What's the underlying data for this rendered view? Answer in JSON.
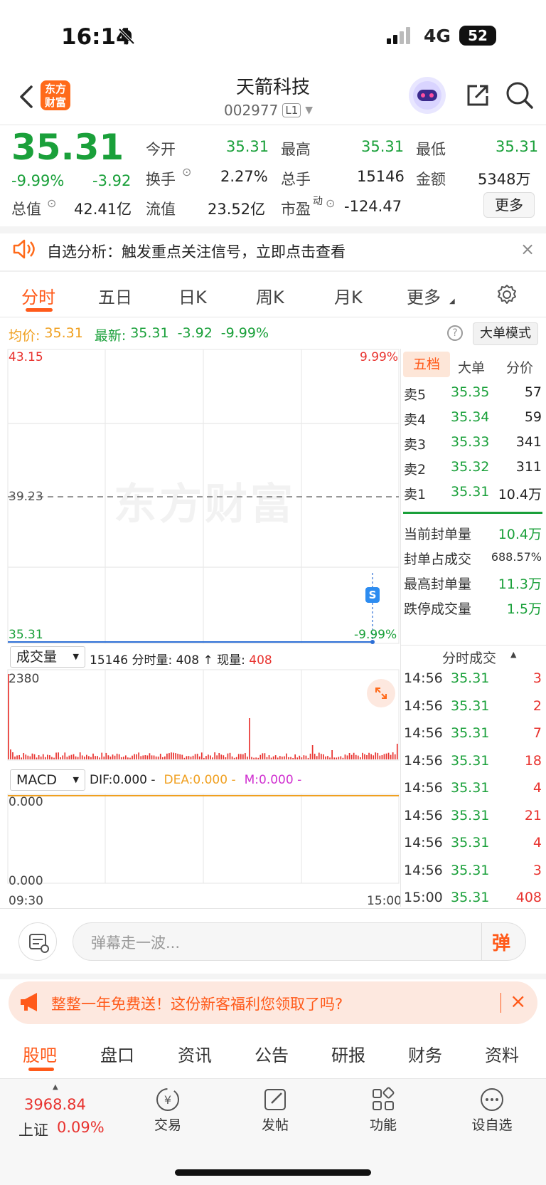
{
  "status": {
    "time": "16:14",
    "network": "4G",
    "battery": "52"
  },
  "header": {
    "logo_text": "东方财富",
    "stock_name": "天箭科技",
    "stock_code": "002977",
    "level": "L1"
  },
  "quote": {
    "price": "35.31",
    "change_pct": "-9.99%",
    "change": "-3.92",
    "open_label": "今开",
    "open": "35.31",
    "high_label": "最高",
    "high": "35.31",
    "low_label": "最低",
    "low": "35.31",
    "turnover_label": "换手",
    "turnover": "2.27%",
    "volume_label": "总手",
    "volume": "15146",
    "amount_label": "金额",
    "amount": "5348万",
    "mcap_label": "总值",
    "mcap": "42.41亿",
    "float_label": "流值",
    "float": "23.52亿",
    "pe_label": "市盈",
    "pe_sup": "动",
    "pe": "-124.47",
    "more_btn": "更多"
  },
  "banner": {
    "text": "自选分析：触发重点关注信号，立即点击查看"
  },
  "tabs": [
    "分时",
    "五日",
    "日K",
    "周K",
    "月K",
    "更多"
  ],
  "intraday": {
    "avg_label": "均价:",
    "avg": "35.31",
    "latest_label": "最新:",
    "latest": "35.31",
    "latest_change": "-3.92",
    "latest_pct": "-9.99%",
    "big_order_btn": "大单模式",
    "y_top": "43.15",
    "y_mid": "39.23",
    "y_bottom": "35.31",
    "pct_top": "9.99%",
    "pct_bottom": "-9.99%",
    "watermark": "东方财富",
    "marker": "S"
  },
  "volume_panel": {
    "selector": "成交量",
    "info_prefix": "15146 分时量: 408 ↑ 现量: ",
    "current": "408",
    "max": "2380"
  },
  "macd_panel": {
    "selector": "MACD",
    "dif": "DIF:0.000 -",
    "dea": "DEA:0.000 -",
    "m": "M:0.000 -",
    "top": "0.000",
    "bottom": "0.000"
  },
  "time_axis": {
    "start": "09:30",
    "end": "15:00"
  },
  "orderbook": {
    "tabs": [
      "五档",
      "大单",
      "分价"
    ],
    "asks": [
      {
        "label": "卖5",
        "price": "35.35",
        "vol": "57"
      },
      {
        "label": "卖4",
        "price": "35.34",
        "vol": "59"
      },
      {
        "label": "卖3",
        "price": "35.33",
        "vol": "341"
      },
      {
        "label": "卖2",
        "price": "35.32",
        "vol": "311"
      },
      {
        "label": "卖1",
        "price": "35.31",
        "vol": "10.4万"
      }
    ],
    "stats": [
      {
        "label": "当前封单量",
        "value": "10.4万"
      },
      {
        "label": "封单占成交",
        "value": "688.57%"
      },
      {
        "label": "最高封单量",
        "value": "11.3万"
      },
      {
        "label": "跌停成交量",
        "value": "1.5万"
      }
    ]
  },
  "ticks": {
    "title": "分时成交",
    "rows": [
      {
        "time": "14:56",
        "price": "35.31",
        "vol": "3"
      },
      {
        "time": "14:56",
        "price": "35.31",
        "vol": "2"
      },
      {
        "time": "14:56",
        "price": "35.31",
        "vol": "7"
      },
      {
        "time": "14:56",
        "price": "35.31",
        "vol": "18"
      },
      {
        "time": "14:56",
        "price": "35.31",
        "vol": "4"
      },
      {
        "time": "14:56",
        "price": "35.31",
        "vol": "21"
      },
      {
        "time": "14:56",
        "price": "35.31",
        "vol": "4"
      },
      {
        "time": "14:56",
        "price": "35.31",
        "vol": "3"
      },
      {
        "time": "15:00",
        "price": "35.31",
        "vol": "408"
      }
    ]
  },
  "danmu": {
    "placeholder": "弹幕走一波...",
    "btn": "弹"
  },
  "promo": {
    "text": "整整一年免费送！这份新客福利您领取了吗?"
  },
  "sub_tabs": [
    "股吧",
    "盘口",
    "资讯",
    "公告",
    "研报",
    "财务",
    "资料"
  ],
  "bottom": {
    "index_value": "3968.84",
    "index_name": "上证",
    "index_pct": "0.09%",
    "trade": "交易",
    "post": "发帖",
    "func": "功能",
    "watch": "设自选"
  }
}
